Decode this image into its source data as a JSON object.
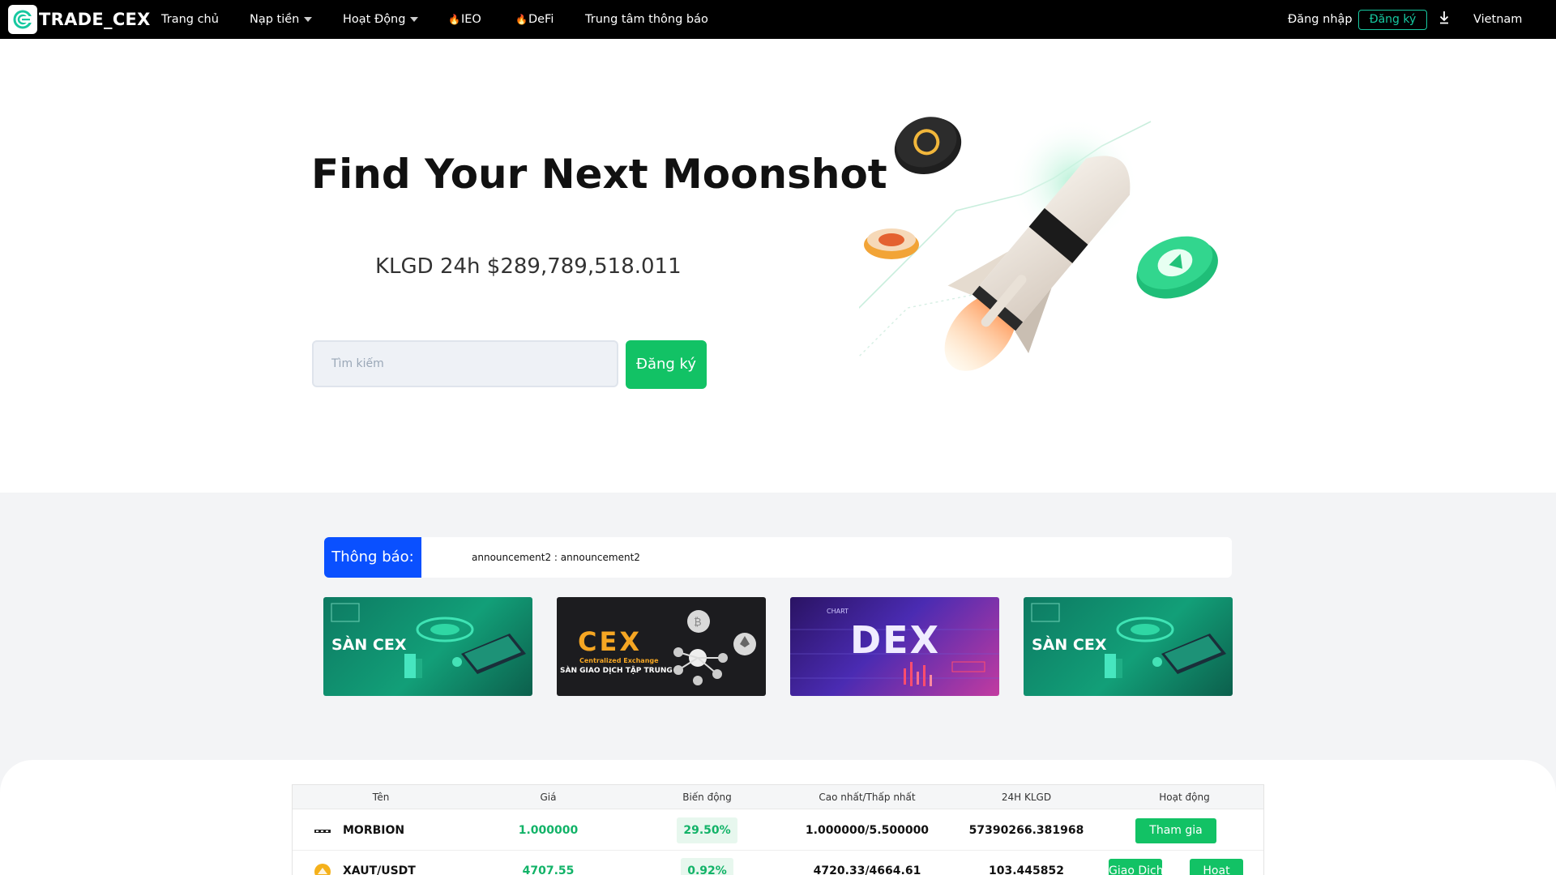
{
  "nav": {
    "brand": "TRADE_CEX",
    "items": [
      {
        "label": "Trang chủ"
      },
      {
        "label": "Nạp tiền"
      },
      {
        "label": "Hoạt Động"
      },
      {
        "label": "IEO"
      },
      {
        "label": "DeFi"
      },
      {
        "label": "Trung tâm thông báo"
      }
    ],
    "login": "Đăng nhập",
    "register": "Đăng ký",
    "language": "Vietnam",
    "download_icon": "download-icon"
  },
  "hero": {
    "title": "Find Your Next Moonshot",
    "volume": "KLGD 24h $289,789,518.011",
    "search_placeholder": "Tìm kiếm",
    "register_button": "Đăng ký"
  },
  "announcement": {
    "label": "Thông báo:",
    "text": "announcement2 : announcement2"
  },
  "banners": [
    {
      "label": "SÀN CEX"
    },
    {
      "label": "CEX",
      "sub1": "Centralized Exchange",
      "sub2": "SÀN GIAO DỊCH TẬP TRUNG"
    },
    {
      "label": "DEX"
    },
    {
      "label": "SÀN CEX"
    }
  ],
  "table": {
    "headers": [
      "Tên",
      "Giá",
      "Biến động",
      "Cao nhất/Thấp nhất",
      "24H KLGD",
      "Hoạt động"
    ],
    "rows": [
      {
        "name": "MORBION",
        "price": "1.000000",
        "change": "29.50%",
        "high_low": "1.000000/5.500000",
        "volume": "57390266.381968",
        "action": "Tham gia"
      },
      {
        "name": "XAUT/USDT",
        "price": "4707.55",
        "change": "0.92%",
        "high_low": "4720.33/4664.61",
        "volume": "103.445852",
        "action1": "Giao Dịch",
        "action2": "Hoạt"
      }
    ]
  },
  "colors": {
    "accent_green": "#12c265",
    "teal": "#17c8a0",
    "announcement_blue": "#0a50ff",
    "nav_bg": "#000000"
  }
}
